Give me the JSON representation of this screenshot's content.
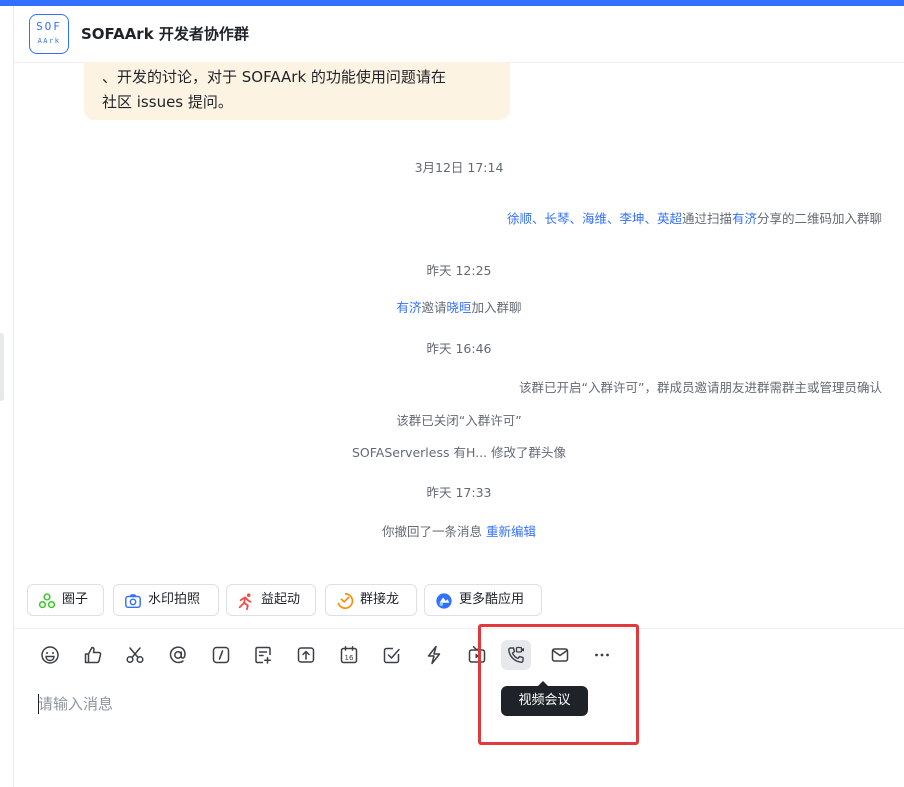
{
  "header": {
    "logo_line1": "SOF",
    "logo_line2": "AArk",
    "title": "SOFAArk 开发者协作群"
  },
  "bubble": {
    "line1": "、开发的讨论，对于 SOFAArk 的功能使用问题请在",
    "line2": "社区 issues 提问。"
  },
  "system": {
    "ts1": "3月12日 17:14",
    "join1": {
      "names": "徐顺、长琴、海维、李坤、英超",
      "mid": "通过扫描",
      "sharer": "有济",
      "tail": "分享的二维码加入群聊"
    },
    "ts2": "昨天 12:25",
    "invite": {
      "inviter": "有济",
      "mid": "邀请",
      "invitee": "晓晅",
      "tail": "加入群聊"
    },
    "ts3": "昨天 16:46",
    "perm_on": "该群已开启“入群许可”，群成员邀请朋友进群需群主或管理员确认",
    "perm_off": "该群已关闭“入群许可”",
    "avatar_change": "SOFAServerless 有H... 修改了群头像",
    "ts4": "昨天 17:33",
    "recall": "你撤回了一条消息",
    "reedit": "重新编辑"
  },
  "apps": [
    {
      "label": "圈子",
      "icon": "circle-group-icon"
    },
    {
      "label": "水印拍照",
      "icon": "camera-icon"
    },
    {
      "label": "益起动",
      "icon": "running-icon"
    },
    {
      "label": "群接龙",
      "icon": "relay-icon"
    },
    {
      "label": "更多酷应用",
      "icon": "more-apps-icon"
    }
  ],
  "toolbar": {
    "icons": [
      "emoji-icon",
      "thumbs-up-icon",
      "scissors-icon",
      "at-icon",
      "slash-command-icon",
      "doc-add-icon",
      "upload-icon",
      "calendar-icon",
      "task-check-icon",
      "lightning-icon",
      "live-icon",
      "video-meeting-icon",
      "mail-icon",
      "more-icon"
    ],
    "calendar_day": "16"
  },
  "tooltip": "视频会议",
  "composer": {
    "placeholder": "请输入消息"
  },
  "colors": {
    "accent": "#3370ff",
    "highlight": "#e0393e",
    "bubble": "#fdf3e2"
  }
}
